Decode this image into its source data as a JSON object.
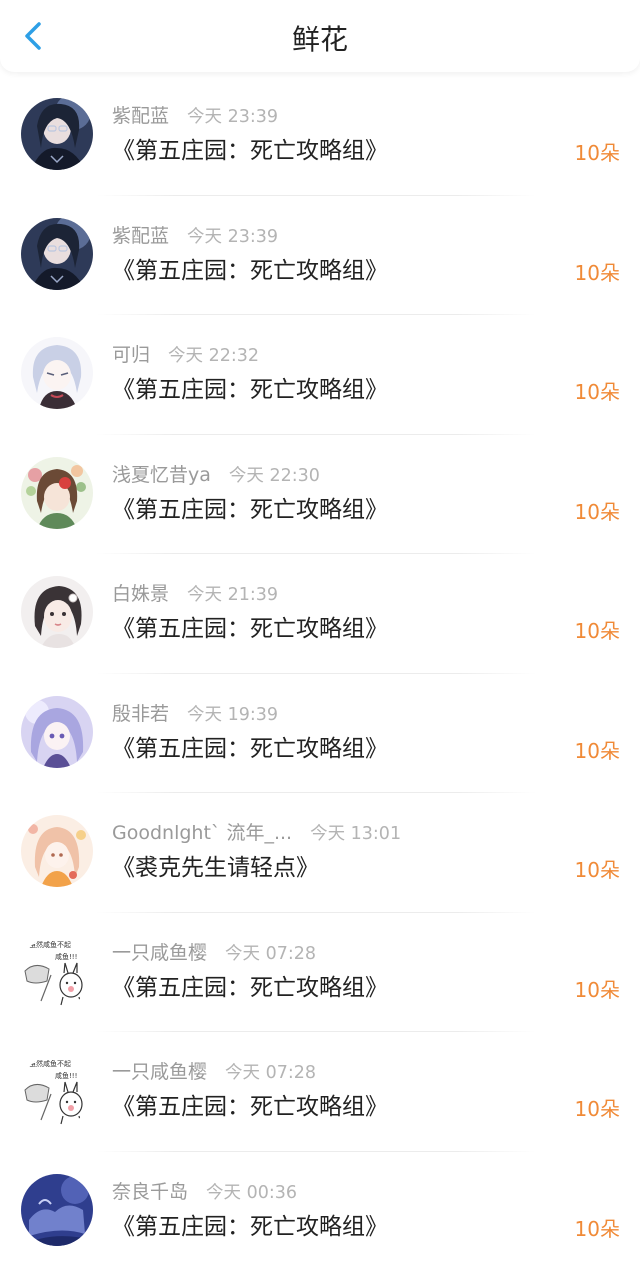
{
  "header": {
    "title": "鲜花",
    "back_icon": "chevron-left-icon",
    "accent": "#2d9fe6"
  },
  "accent_count_color": "#f08a37",
  "items": [
    {
      "name": "紫配蓝",
      "time": "今天 23:39",
      "work": "《第五庄园：死亡攻略组》",
      "count": "10朵",
      "avatar": "avatar-purple"
    },
    {
      "name": "紫配蓝",
      "time": "今天 23:39",
      "work": "《第五庄园：死亡攻略组》",
      "count": "10朵",
      "avatar": "avatar-purple"
    },
    {
      "name": "可归",
      "time": "今天 22:32",
      "work": "《第五庄园：死亡攻略组》",
      "count": "10朵",
      "avatar": "avatar-silver"
    },
    {
      "name": "浅夏忆昔ya",
      "time": "今天 22:30",
      "work": "《第五庄园：死亡攻略组》",
      "count": "10朵",
      "avatar": "avatar-floral"
    },
    {
      "name": "白姝景",
      "time": "今天 21:39",
      "work": "《第五庄园：死亡攻略组》",
      "count": "10朵",
      "avatar": "avatar-pale"
    },
    {
      "name": "殷非若",
      "time": "今天 19:39",
      "work": "《第五庄园：死亡攻略组》",
      "count": "10朵",
      "avatar": "avatar-lilac"
    },
    {
      "name": "Goodnlght` 流年_...",
      "time": "今天 13:01",
      "work": "《裘克先生请轻点》",
      "count": "10朵",
      "avatar": "avatar-peach"
    },
    {
      "name": "一只咸鱼樱",
      "time": "今天 07:28",
      "work": "《第五庄园：死亡攻略组》",
      "count": "10朵",
      "avatar": "avatar-meme",
      "avatar_text": [
        "虽然咸鱼不起",
        "咸鱼!!!"
      ]
    },
    {
      "name": "一只咸鱼樱",
      "time": "今天 07:28",
      "work": "《第五庄园：死亡攻略组》",
      "count": "10朵",
      "avatar": "avatar-meme",
      "avatar_text": [
        "虽然咸鱼不起",
        "咸鱼!!!"
      ]
    },
    {
      "name": "奈良千岛",
      "time": "今天 00:36",
      "work": "《第五庄园：死亡攻略组》",
      "count": "10朵",
      "avatar": "avatar-blue"
    }
  ]
}
